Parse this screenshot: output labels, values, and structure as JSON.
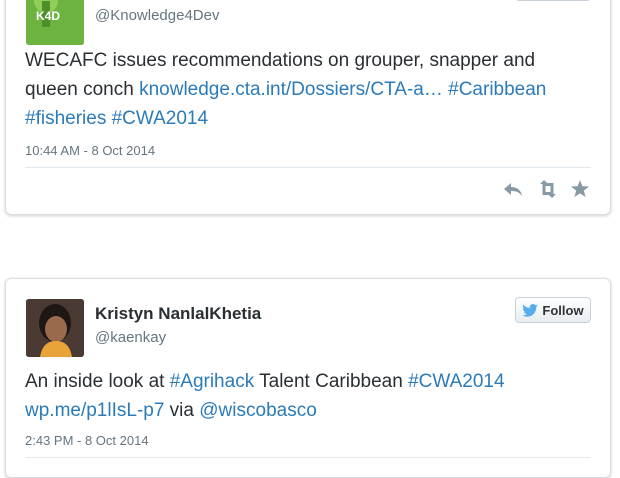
{
  "tweets": [
    {
      "avatar_text": "K4D",
      "handle": "@Knowledge4Dev",
      "text_segments": [
        {
          "text": "WECAFC issues recommendations on grouper, snapper and queen conch ",
          "link": false
        },
        {
          "text": "knowledge.cta.int/Dossiers/CTA-a…",
          "link": true
        },
        {
          "text": " ",
          "link": false
        },
        {
          "text": "#Caribbean",
          "link": true
        },
        {
          "text": " ",
          "link": false
        },
        {
          "text": "#fisheries",
          "link": true
        },
        {
          "text": " ",
          "link": false
        },
        {
          "text": "#CWA2014",
          "link": true
        }
      ],
      "timestamp": "10:44 AM - 8 Oct 2014",
      "actions": [
        "reply-icon",
        "retweet-icon",
        "favorite-icon"
      ]
    },
    {
      "display_name": "Kristyn NanlalKhetia",
      "handle": "@kaenkay",
      "follow_label": "Follow",
      "text_segments": [
        {
          "text": "An inside look at ",
          "link": false
        },
        {
          "text": "#Agrihack",
          "link": true
        },
        {
          "text": " Talent Caribbean ",
          "link": false
        },
        {
          "text": "#CWA2014",
          "link": true
        },
        {
          "text": " ",
          "link": false
        },
        {
          "text": "wp.me/p1lIsL-p7",
          "link": true
        },
        {
          "text": " via ",
          "link": false
        },
        {
          "text": "@wiscobasco",
          "link": true
        }
      ],
      "timestamp": "2:43 PM - 8 Oct 2014"
    }
  ],
  "colors": {
    "link": "#2b7bb9",
    "muted": "#66757f",
    "twitter_bird": "#55acee",
    "k4d_green": "#6db33f"
  }
}
